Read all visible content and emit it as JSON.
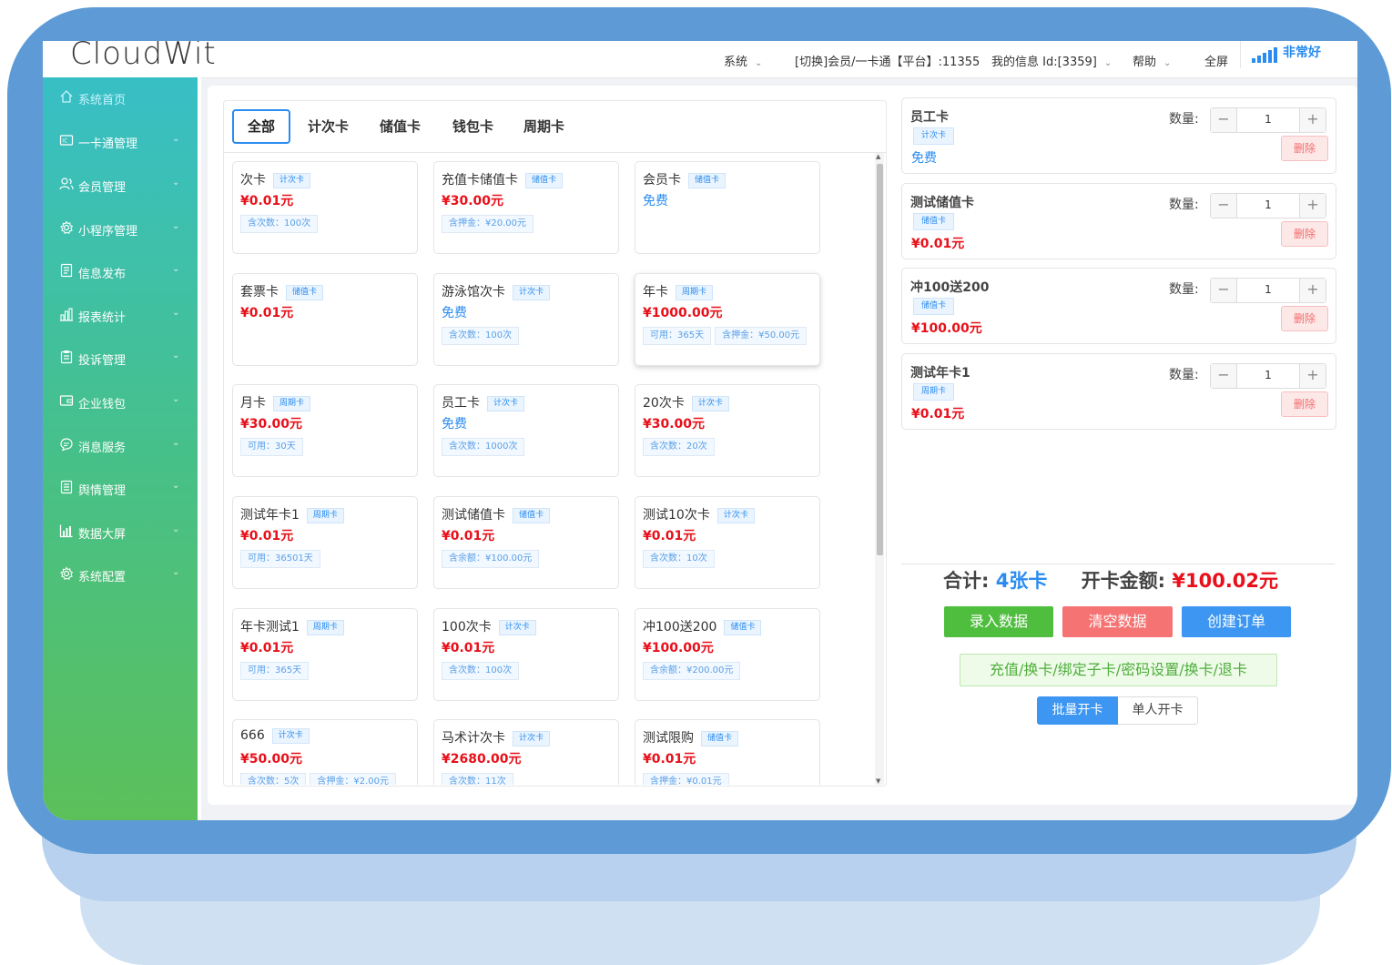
{
  "header": {
    "logo": "CloudWit",
    "nav": [
      {
        "label": "系统",
        "has_dropdown": true
      },
      {
        "label": "[切换]会员/一卡通【平台】:11355",
        "has_dropdown": false
      },
      {
        "label": "我的信息 Id:[3359]",
        "has_dropdown": true
      },
      {
        "label": "帮助",
        "has_dropdown": true
      },
      {
        "label": "全屏",
        "has_dropdown": false
      }
    ],
    "signal_text": "非常好",
    "chevron": "⌄"
  },
  "sidebar": {
    "items": [
      {
        "label": "系统首页",
        "icon": "home-icon",
        "active": true
      },
      {
        "label": "一卡通管理",
        "icon": "card-icon"
      },
      {
        "label": "会员管理",
        "icon": "users-icon"
      },
      {
        "label": "小程序管理",
        "icon": "gear-icon"
      },
      {
        "label": "信息发布",
        "icon": "document-icon"
      },
      {
        "label": "报表统计",
        "icon": "bar-chart-icon"
      },
      {
        "label": "投诉管理",
        "icon": "clipboard-icon"
      },
      {
        "label": "企业钱包",
        "icon": "wallet-icon"
      },
      {
        "label": "消息服务",
        "icon": "message-icon"
      },
      {
        "label": "舆情管理",
        "icon": "list-icon"
      },
      {
        "label": "数据大屏",
        "icon": "chart-icon"
      },
      {
        "label": "系统配置",
        "icon": "settings-icon"
      }
    ]
  },
  "tabs": [
    "全部",
    "计次卡",
    "储值卡",
    "钱包卡",
    "周期卡"
  ],
  "cards": [
    {
      "name": "次卡",
      "tag": "计次卡",
      "price": "¥0.01元",
      "free": false,
      "meta": [
        "含次数：100次"
      ]
    },
    {
      "name": "充值卡储值卡",
      "tag": "储值卡",
      "price": "¥30.00元",
      "free": false,
      "meta": [
        "含押金：¥20.00元"
      ]
    },
    {
      "name": "会员卡",
      "tag": "储值卡",
      "price": "免费",
      "free": true,
      "meta": []
    },
    {
      "name": "套票卡",
      "tag": "储值卡",
      "price": "¥0.01元",
      "free": false,
      "meta": []
    },
    {
      "name": "游泳馆次卡",
      "tag": "计次卡",
      "price": "免费",
      "free": true,
      "meta": [
        "含次数：100次"
      ]
    },
    {
      "name": "年卡",
      "tag": "周期卡",
      "price": "¥1000.00元",
      "free": false,
      "meta": [
        "可用：365天",
        "含押金：¥50.00元"
      ]
    },
    {
      "name": "月卡",
      "tag": "周期卡",
      "price": "¥30.00元",
      "free": false,
      "meta": [
        "可用：30天"
      ]
    },
    {
      "name": "员工卡",
      "tag": "计次卡",
      "price": "免费",
      "free": true,
      "meta": [
        "含次数：1000次"
      ]
    },
    {
      "name": "20次卡",
      "tag": "计次卡",
      "price": "¥30.00元",
      "free": false,
      "meta": [
        "含次数：20次"
      ]
    },
    {
      "name": "测试年卡1",
      "tag": "周期卡",
      "price": "¥0.01元",
      "free": false,
      "meta": [
        "可用：36501天"
      ]
    },
    {
      "name": "测试储值卡",
      "tag": "储值卡",
      "price": "¥0.01元",
      "free": false,
      "meta": [
        "含余额：¥100.00元"
      ]
    },
    {
      "name": "测试10次卡",
      "tag": "计次卡",
      "price": "¥0.01元",
      "free": false,
      "meta": [
        "含次数：10次"
      ]
    },
    {
      "name": "年卡测试1",
      "tag": "周期卡",
      "price": "¥0.01元",
      "free": false,
      "meta": [
        "可用：365天"
      ]
    },
    {
      "name": "100次卡",
      "tag": "计次卡",
      "price": "¥0.01元",
      "free": false,
      "meta": [
        "含次数：100次"
      ]
    },
    {
      "name": "冲100送200",
      "tag": "储值卡",
      "price": "¥100.00元",
      "free": false,
      "meta": [
        "含余额：¥200.00元"
      ]
    },
    {
      "name": "666",
      "tag": "计次卡",
      "price": "¥50.00元",
      "free": false,
      "meta": [
        "含次数：5次",
        "含押金：¥2.00元"
      ]
    },
    {
      "name": "马术计次卡",
      "tag": "计次卡",
      "price": "¥2680.00元",
      "free": false,
      "meta": [
        "含次数：11次"
      ]
    },
    {
      "name": "测试限购",
      "tag": "储值卡",
      "price": "¥0.01元",
      "free": false,
      "meta": [
        "含押金：¥0.01元"
      ]
    }
  ],
  "cart": {
    "qty_label": "数量:",
    "delete_label": "删除",
    "items": [
      {
        "name": "员工卡",
        "tag": "计次卡",
        "price": "免费",
        "free": true,
        "qty": "1"
      },
      {
        "name": "测试储值卡",
        "tag": "储值卡",
        "price": "¥0.01元",
        "free": false,
        "qty": "1"
      },
      {
        "name": "冲100送200",
        "tag": "储值卡",
        "price": "¥100.00元",
        "free": false,
        "qty": "1"
      },
      {
        "name": "测试年卡1",
        "tag": "周期卡",
        "price": "¥0.01元",
        "free": false,
        "qty": "1"
      }
    ]
  },
  "summary": {
    "total_label": "合计:",
    "total_count": "4张卡",
    "amount_label": "开卡金额:",
    "amount": "¥100.02元"
  },
  "actions": {
    "enter_data": "录入数据",
    "clear_data": "清空数据",
    "create_order": "创建订单",
    "recharge": "充值/换卡/绑定子卡/密码设置/换卡/退卡",
    "batch_open": "批量开卡",
    "single_open": "单人开卡"
  },
  "colors": {
    "accent": "#2a8cf0",
    "price": "#e8101a",
    "frame": "#5e9bd6",
    "sidebar_top": "#38bfc6",
    "sidebar_bottom": "#5cc05a"
  }
}
